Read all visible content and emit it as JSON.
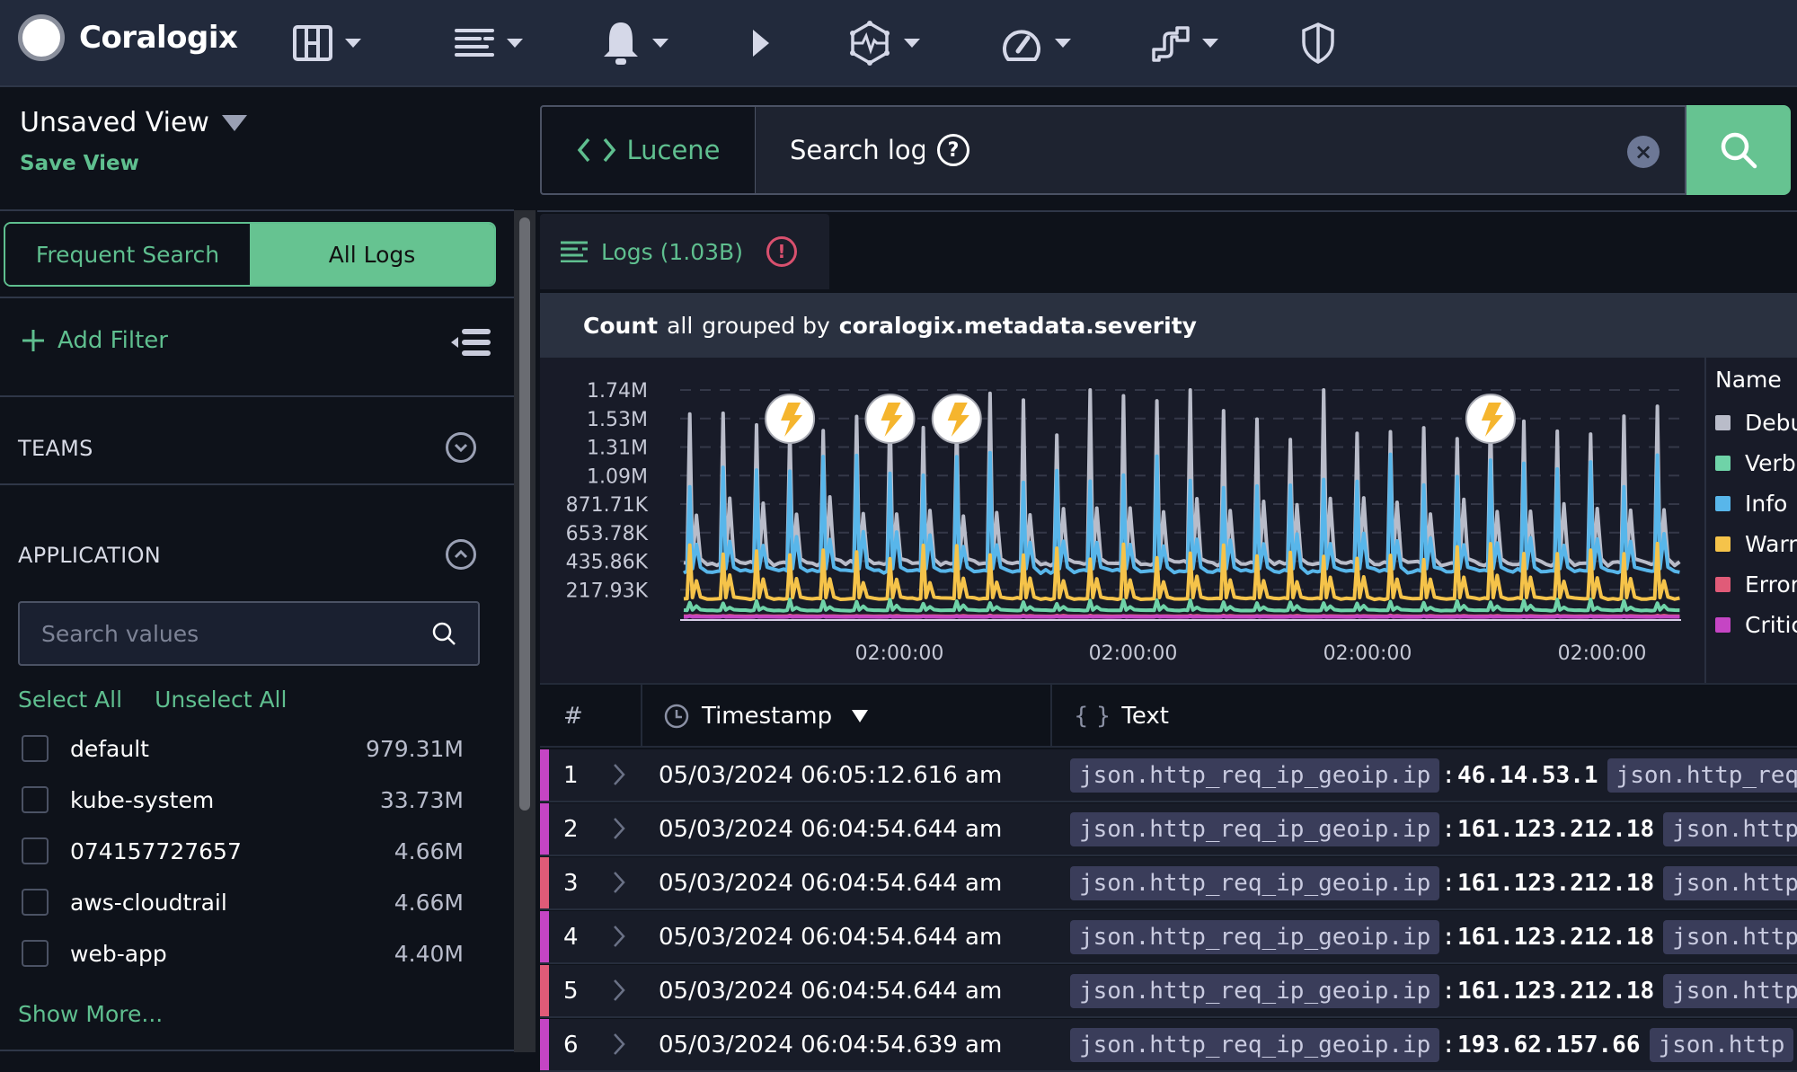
{
  "app": {
    "name": "Coralogix",
    "nav": [
      {
        "icon": "dashboard-icon"
      },
      {
        "icon": "logs-icon"
      },
      {
        "icon": "alerts-bell-icon"
      },
      {
        "icon": "livetail-play-icon"
      },
      {
        "icon": "apm-monitoring-icon"
      },
      {
        "icon": "metrics-gauge-icon"
      },
      {
        "icon": "data-flow-icon"
      },
      {
        "icon": "security-shield-icon"
      }
    ]
  },
  "view": {
    "title": "Unsaved View",
    "save_label": "Save View"
  },
  "sidebar": {
    "tabs": [
      {
        "label": "Frequent Search",
        "active": false
      },
      {
        "label": "All Logs",
        "active": true
      }
    ],
    "add_filter_label": "Add Filter",
    "sections": [
      {
        "title": "TEAMS",
        "expanded": false
      },
      {
        "title": "APPLICATION",
        "expanded": true
      }
    ],
    "search_placeholder": "Search values",
    "select_all": "Select All",
    "unselect_all": "Unselect All",
    "applications": [
      {
        "name": "default",
        "count": "979.31M",
        "checked": false
      },
      {
        "name": "kube-system",
        "count": "33.73M",
        "checked": false
      },
      {
        "name": "074157727657",
        "count": "4.66M",
        "checked": false
      },
      {
        "name": "aws-cloudtrail",
        "count": "4.66M",
        "checked": false
      },
      {
        "name": "web-app",
        "count": "4.40M",
        "checked": false
      }
    ],
    "show_more": "Show More..."
  },
  "search": {
    "mode_label": "Lucene",
    "placeholder": "Search logs",
    "help": "?",
    "clear": "×"
  },
  "results": {
    "tab_label": "Logs (1.03B)",
    "warning": "!",
    "query": {
      "agg": "Count",
      "scope": "all",
      "grouped": "grouped by",
      "field": "coralogix.metadata.severity"
    }
  },
  "chart_data": {
    "type": "line",
    "title": "Count all grouped by coralogix.metadata.severity",
    "yticks": [
      "217.93K",
      "435.86K",
      "653.78K",
      "871.71K",
      "1.09M",
      "1.31M",
      "1.53M",
      "1.74M"
    ],
    "ylim": [
      0,
      1740000
    ],
    "xticks": [
      "02:00:00",
      "02:00:00",
      "02:00:00",
      "02:00:00"
    ],
    "legend_title": "Name",
    "legend_position": "right",
    "grid": true,
    "series": [
      {
        "name": "Debug",
        "color": "#b9bcc9",
        "baseline": 420000,
        "peak": 1600000,
        "sub_peak": 850000
      },
      {
        "name": "Verbose",
        "color": "#6fd3a8",
        "baseline": 60000,
        "peak": 130000,
        "sub_peak": 90000
      },
      {
        "name": "Info",
        "color": "#58b6ea",
        "baseline": 360000,
        "peak": 1150000,
        "sub_peak": 600000
      },
      {
        "name": "Warning",
        "color": "#f5c34a",
        "baseline": 150000,
        "peak": 520000,
        "sub_peak": 300000
      },
      {
        "name": "Error",
        "color": "#e05b78",
        "baseline": 15000,
        "peak": 20000,
        "sub_peak": 18000
      },
      {
        "name": "Critical",
        "color": "#c545c4",
        "baseline": 10000,
        "peak": 15000,
        "sub_peak": 12000
      }
    ],
    "peaks_count": 30,
    "annotations": [
      {
        "type": "anomaly-bolt",
        "index": 3
      },
      {
        "type": "anomaly-bolt",
        "index": 6
      },
      {
        "type": "anomaly-bolt",
        "index": 8
      },
      {
        "type": "anomaly-bolt",
        "index": 24
      }
    ]
  },
  "table": {
    "columns": [
      "#",
      "Timestamp",
      "Text"
    ],
    "rows": [
      {
        "n": "1",
        "severity": "#c545c4",
        "ts": "05/03/2024 06:05:12.616 am",
        "key": "json.http_req_ip_geoip.ip",
        "value": "46.14.53.1",
        "next_key": "json.http_req"
      },
      {
        "n": "2",
        "severity": "#c545c4",
        "ts": "05/03/2024 06:04:54.644 am",
        "key": "json.http_req_ip_geoip.ip",
        "value": "161.123.212.18",
        "next_key": "json.http"
      },
      {
        "n": "3",
        "severity": "#e05b78",
        "ts": "05/03/2024 06:04:54.644 am",
        "key": "json.http_req_ip_geoip.ip",
        "value": "161.123.212.18",
        "next_key": "json.http"
      },
      {
        "n": "4",
        "severity": "#c545c4",
        "ts": "05/03/2024 06:04:54.644 am",
        "key": "json.http_req_ip_geoip.ip",
        "value": "161.123.212.18",
        "next_key": "json.http"
      },
      {
        "n": "5",
        "severity": "#e05b78",
        "ts": "05/03/2024 06:04:54.644 am",
        "key": "json.http_req_ip_geoip.ip",
        "value": "161.123.212.18",
        "next_key": "json.http"
      },
      {
        "n": "6",
        "severity": "#c545c4",
        "ts": "05/03/2024 06:04:54.639 am",
        "key": "json.http_req_ip_geoip.ip",
        "value": "193.62.157.66",
        "next_key": "json.http"
      }
    ]
  },
  "colors": {
    "accent": "#66c391",
    "accent_text": "#5fbf8f",
    "topbar": "#222a3c",
    "background": "#0e121a"
  }
}
